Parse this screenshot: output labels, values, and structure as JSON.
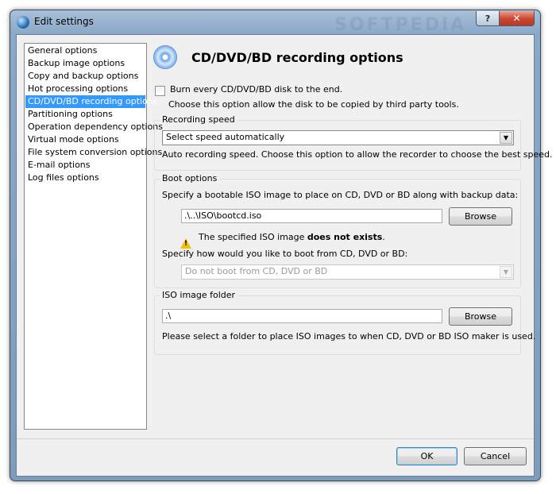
{
  "window": {
    "title": "Edit settings",
    "help_label": "?",
    "close_label": "✕",
    "watermark": "SOFTPEDIA"
  },
  "sidebar": {
    "items": [
      {
        "label": "General options"
      },
      {
        "label": "Backup image options"
      },
      {
        "label": "Copy and backup options"
      },
      {
        "label": "Hot processing options"
      },
      {
        "label": "CD/DVD/BD recording options",
        "selected": true
      },
      {
        "label": "Partitioning options"
      },
      {
        "label": "Operation dependency options"
      },
      {
        "label": "Virtual mode options"
      },
      {
        "label": "File system conversion options"
      },
      {
        "label": "E-mail options"
      },
      {
        "label": "Log files options"
      }
    ]
  },
  "page": {
    "title": "CD/DVD/BD recording options",
    "icon": "disc-icon"
  },
  "burn_option": {
    "label": "Burn every CD/DVD/BD disk to the end.",
    "checked": false,
    "description": "Choose this option allow the disk to be copied by third party tools."
  },
  "recording_speed": {
    "group_title": "Recording speed",
    "selected": "Select speed automatically",
    "description": "Auto recording speed. Choose this option to allow the recorder to choose the best speed."
  },
  "boot_options": {
    "group_title": "Boot options",
    "instruction": "Specify a bootable ISO image to place on CD, DVD or BD along with backup data:",
    "iso_path": ".\\..\\ISO\\bootcd.iso",
    "browse_label": "Browse",
    "warning_prefix": "The specified ISO image ",
    "warning_bold": "does not exists",
    "warning_suffix": ".",
    "boot_question": "Specify how would you like to boot from CD, DVD or BD:",
    "boot_selected": "Do not boot from CD, DVD or BD"
  },
  "iso_folder": {
    "group_title": "ISO image folder",
    "path": ".\\",
    "browse_label": "Browse",
    "description": "Please select a folder to place ISO images to when CD, DVD or BD ISO maker is used."
  },
  "footer": {
    "ok_label": "OK",
    "cancel_label": "Cancel"
  },
  "colors": {
    "selection": "#3399ff",
    "titlebar": "#8aa8c8",
    "close": "#c8452f",
    "warning": "#f2c200"
  }
}
